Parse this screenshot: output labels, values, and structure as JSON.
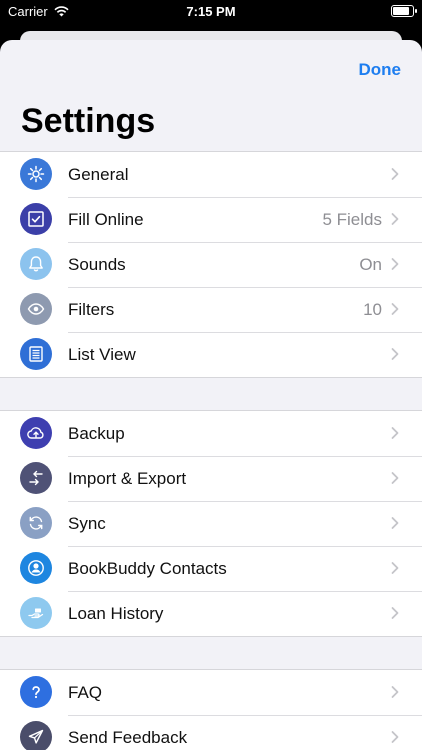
{
  "status_bar": {
    "carrier": "Carrier",
    "time": "7:15 PM"
  },
  "header": {
    "done_label": "Done",
    "title": "Settings"
  },
  "groups": [
    {
      "items": [
        {
          "name": "general",
          "label": "General",
          "value": "",
          "icon": "gear-icon",
          "color": "#3a78d8"
        },
        {
          "name": "fill-online",
          "label": "Fill Online",
          "value": "5 Fields",
          "icon": "checkbox-icon",
          "color": "#3b3fa8"
        },
        {
          "name": "sounds",
          "label": "Sounds",
          "value": "On",
          "icon": "bell-icon",
          "color": "#8cc3ee"
        },
        {
          "name": "filters",
          "label": "Filters",
          "value": "10",
          "icon": "eye-icon",
          "color": "#8e9ab0"
        },
        {
          "name": "list-view",
          "label": "List View",
          "value": "",
          "icon": "list-icon",
          "color": "#2f6fd6"
        }
      ]
    },
    {
      "items": [
        {
          "name": "backup",
          "label": "Backup",
          "value": "",
          "icon": "cloud-icon",
          "color": "#3e3fb0"
        },
        {
          "name": "import-export",
          "label": "Import & Export",
          "value": "",
          "icon": "arrows-icon",
          "color": "#4f5276"
        },
        {
          "name": "sync",
          "label": "Sync",
          "value": "",
          "icon": "sync-icon",
          "color": "#8aa0c4"
        },
        {
          "name": "bookbuddy-contacts",
          "label": "BookBuddy Contacts",
          "value": "",
          "icon": "contact-icon",
          "color": "#1e86e0"
        },
        {
          "name": "loan-history",
          "label": "Loan History",
          "value": "",
          "icon": "hand-icon",
          "color": "#8ec9ef"
        }
      ]
    },
    {
      "items": [
        {
          "name": "faq",
          "label": "FAQ",
          "value": "",
          "icon": "question-icon",
          "color": "#2e6fe0"
        },
        {
          "name": "send-feedback",
          "label": "Send Feedback",
          "value": "",
          "icon": "paperplane-icon",
          "color": "#4a4d6a"
        }
      ]
    }
  ]
}
